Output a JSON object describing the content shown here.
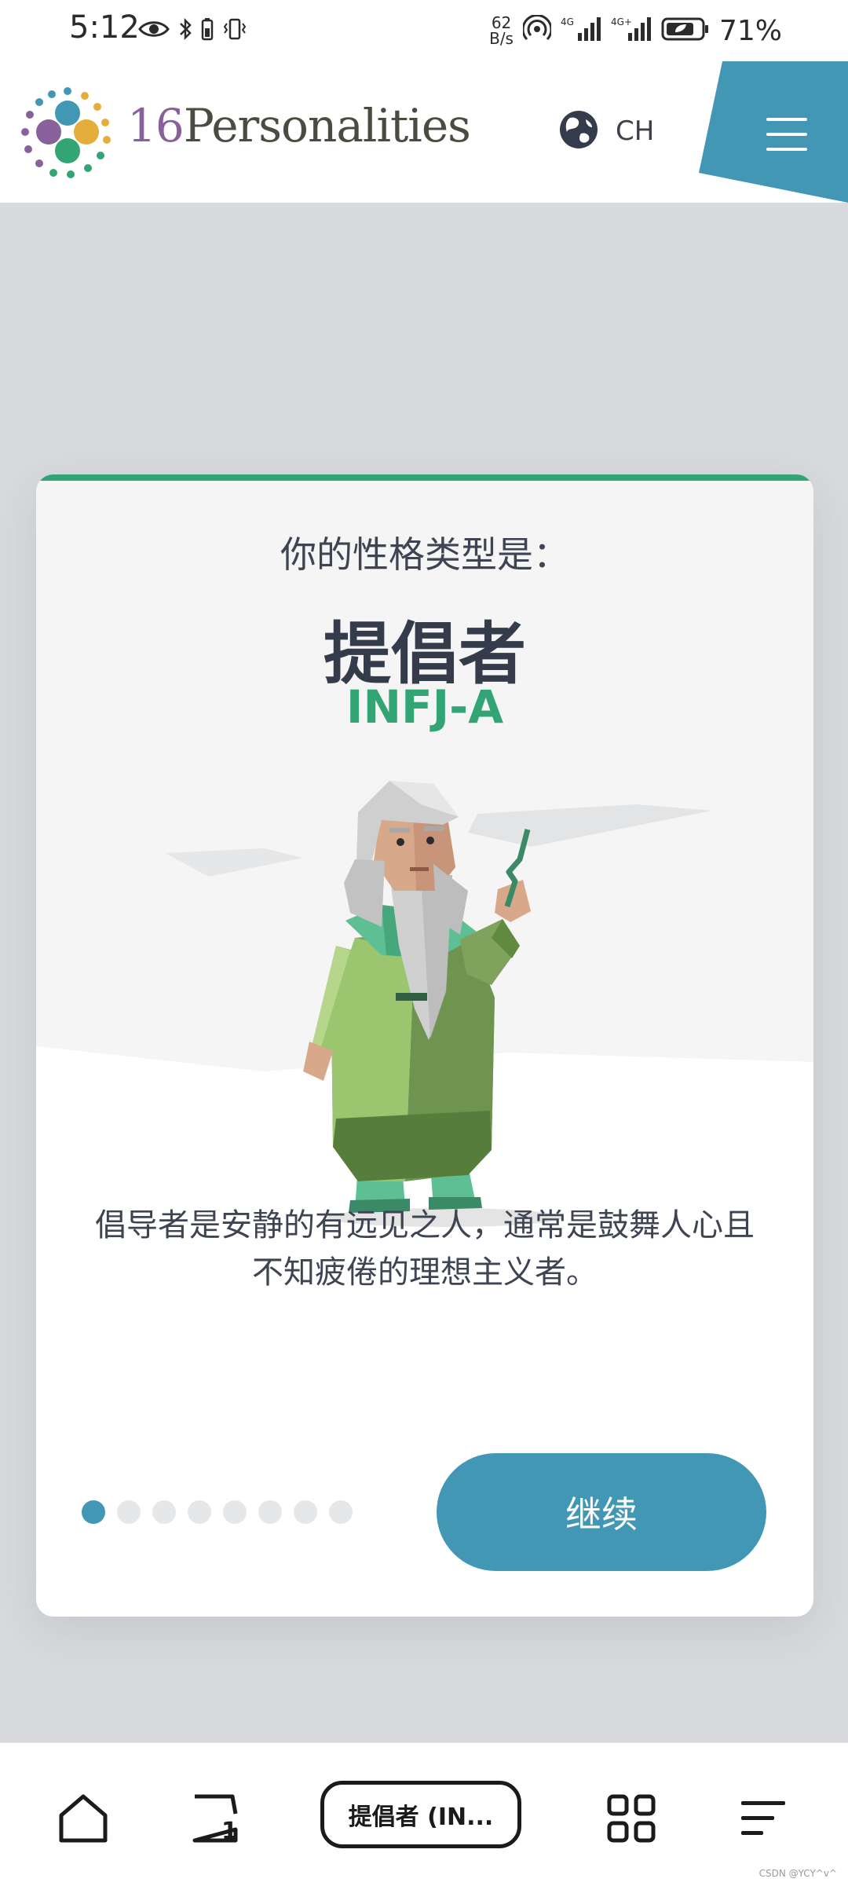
{
  "status_bar": {
    "time": "5:12",
    "net_speed_value": "62",
    "net_speed_unit": "B/s",
    "battery_percent": "71%",
    "icons": [
      "eye-icon",
      "bluetooth-icon",
      "battery-saver-icon",
      "vibrate-icon",
      "hotspot-icon",
      "signal-4g-icon",
      "signal-4g-plus-icon",
      "battery-icon"
    ]
  },
  "header": {
    "logo_digits": "16",
    "logo_text": "Personalities",
    "language_label": "CH",
    "icons": [
      "logo-mark-icon",
      "globe-icon",
      "menu-icon"
    ]
  },
  "card": {
    "intro": "你的性格类型是：",
    "type_name": "提倡者",
    "type_code": "INFJ-A",
    "description": "倡导者是安静的有远见之人，通常是鼓舞人心且不知疲倦的理想主义者。",
    "progress": {
      "total_steps": 8,
      "current_step": 1
    },
    "continue_label": "继续"
  },
  "browser_bar": {
    "address_label": "提倡者 (IN...",
    "icons": [
      "home-icon",
      "tabs-icon",
      "apps-icon",
      "menu-lines-icon"
    ]
  },
  "watermark": "CSDN @YCY^v^",
  "colors": {
    "accent_green": "#33a474",
    "button_blue": "#4298b4",
    "heading_dark": "#343c4b",
    "page_grey": "#d8dadd"
  }
}
